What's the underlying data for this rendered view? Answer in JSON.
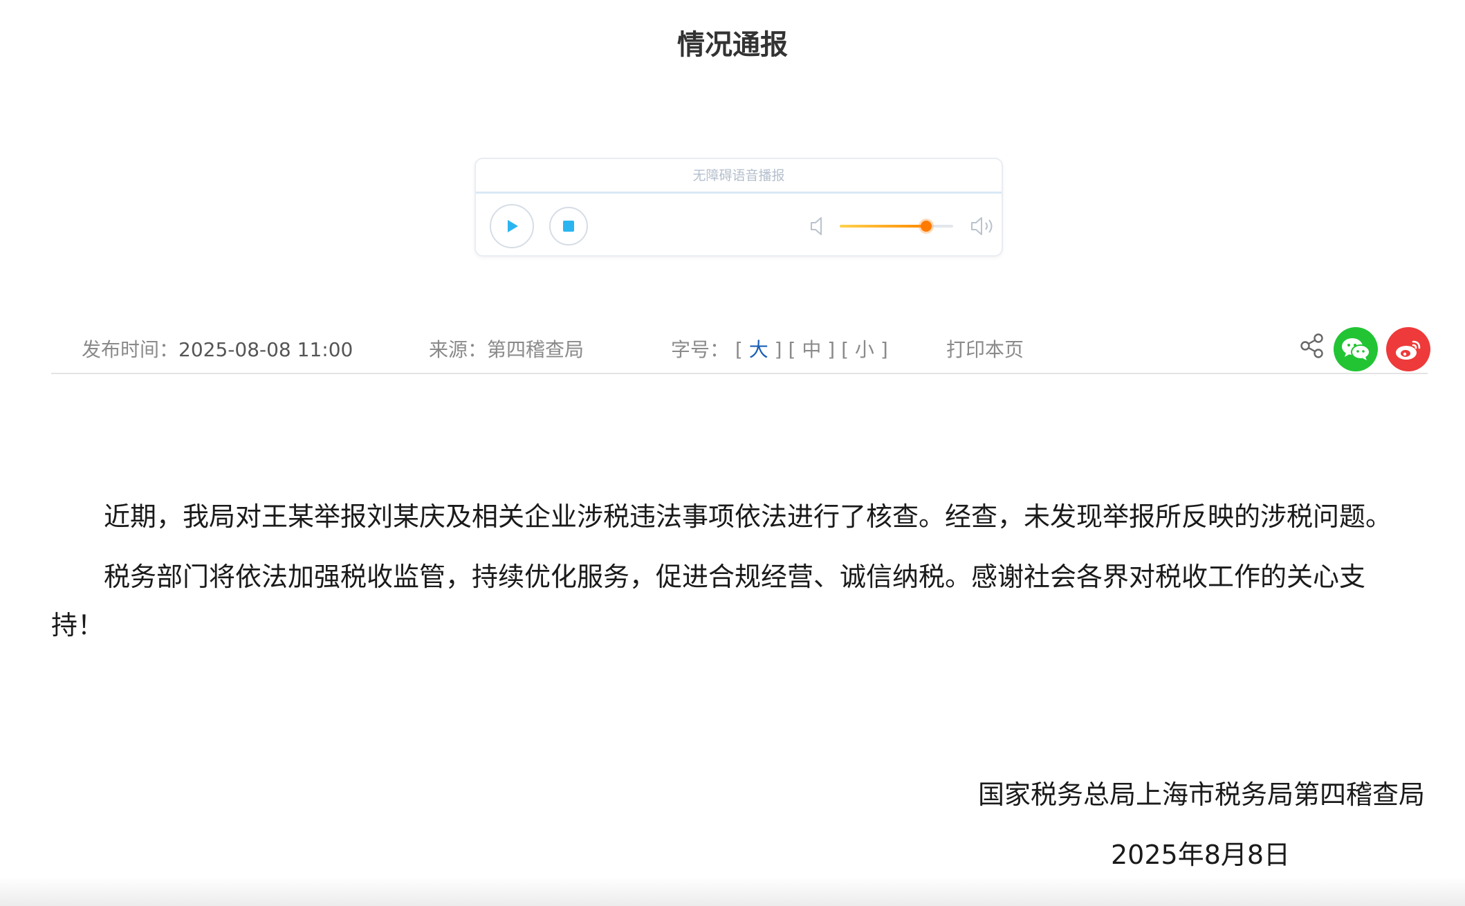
{
  "page": {
    "title": "情况通报"
  },
  "player": {
    "header_label": "无障碍语音播报",
    "volume_level": 0.76,
    "accent_color": "#ff8a00",
    "play_color": "#2bb5f0"
  },
  "meta": {
    "time_label": "发布时间：",
    "time_value": "2025-08-08 11:00",
    "source_text": "来源：第四稽查局",
    "font_label": "字号：",
    "font_sizes": {
      "large": "大",
      "medium": "中",
      "small": "小"
    },
    "font_selected": "大",
    "print_label": "打印本页",
    "share_icons": [
      "share-icon",
      "wechat-icon",
      "weibo-icon"
    ]
  },
  "article": {
    "paragraphs": [
      "近期，我局对王某举报刘某庆及相关企业涉税违法事项依法进行了核查。经查，未发现举报所反映的涉税问题。",
      "税务部门将依法加强税收监管，持续优化服务，促进合规经营、诚信纳税。感谢社会各界对税收工作的关心支持！"
    ],
    "signature": "国家税务总局上海市税务局第四稽查局",
    "date": "2025年8月8日"
  }
}
